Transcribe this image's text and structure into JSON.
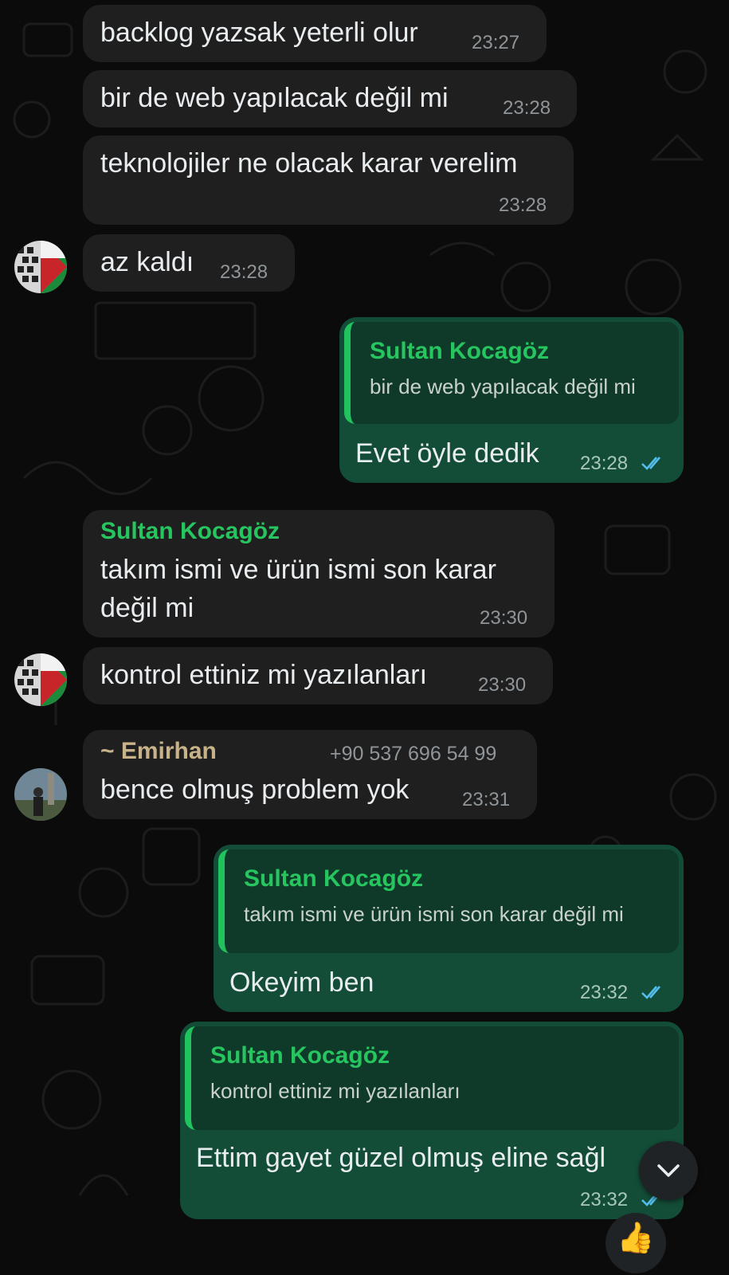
{
  "messages": [
    {
      "text": "backlog yazsak yeterli olur",
      "time": "23:27"
    },
    {
      "text": "bir de web yapılacak değil mi",
      "time": "23:28"
    },
    {
      "text": "teknolojiler ne olacak karar verelim",
      "time": "23:28"
    },
    {
      "text": "az kaldı",
      "time": "23:28"
    },
    {
      "quote_author": "Sultan Kocagöz",
      "quote_text": "bir de web yapılacak değil mi",
      "text": "Evet öyle dedik",
      "time": "23:28"
    },
    {
      "sender": "Sultan Kocagöz",
      "text_line1": "takım ismi ve ürün ismi son karar",
      "text_line2": "değil mi",
      "time": "23:30"
    },
    {
      "text": "kontrol ettiniz mi yazılanları",
      "time": "23:30"
    },
    {
      "sender": "~ Emirhan",
      "phone": "+90 537 696 54 99",
      "text": "bence olmuş problem yok",
      "time": "23:31"
    },
    {
      "quote_author": "Sultan Kocagöz",
      "quote_text": "takım ismi ve ürün ismi son karar değil mi",
      "text": "Okeyim ben",
      "time": "23:32"
    },
    {
      "quote_author": "Sultan Kocagöz",
      "quote_text": "kontrol ettiniz mi yazılanları",
      "text": "Ettim gayet güzel olmuş eline sağl",
      "time": "23:32"
    }
  ],
  "reaction": "👍",
  "icons": {
    "read_receipt": "double-check-icon",
    "scroll_down": "chevron-down-icon"
  },
  "colors": {
    "background": "#0b0b0b",
    "incoming_bubble": "#1f1f1f",
    "outgoing_bubble": "#134d37",
    "sender_green": "#27c55f",
    "sender_tan": "#c8b289",
    "read_tick": "#53bdeb"
  }
}
